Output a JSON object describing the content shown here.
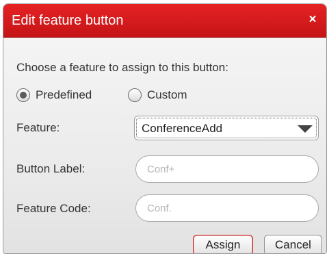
{
  "dialog": {
    "title": "Edit feature button",
    "close_glyph": "×",
    "prompt": "Choose a feature to assign to this button:"
  },
  "feature_type": {
    "options": [
      {
        "label": "Predefined",
        "selected": true
      },
      {
        "label": "Custom",
        "selected": false
      }
    ]
  },
  "fields": {
    "feature": {
      "label": "Feature:",
      "value": "ConferenceAdd"
    },
    "button_label": {
      "label": "Button Label:",
      "value": "",
      "placeholder": "Conf+"
    },
    "feature_code": {
      "label": "Feature Code:",
      "value": "",
      "placeholder": "Conf."
    }
  },
  "actions": {
    "assign": "Assign",
    "cancel": "Cancel"
  },
  "colors": {
    "title_bar": "#d71c1e",
    "primary_button_border": "#c41416",
    "dialog_background": "#ececec"
  },
  "icons": {
    "close": "close-icon",
    "dropdown": "chevron-down-icon"
  }
}
